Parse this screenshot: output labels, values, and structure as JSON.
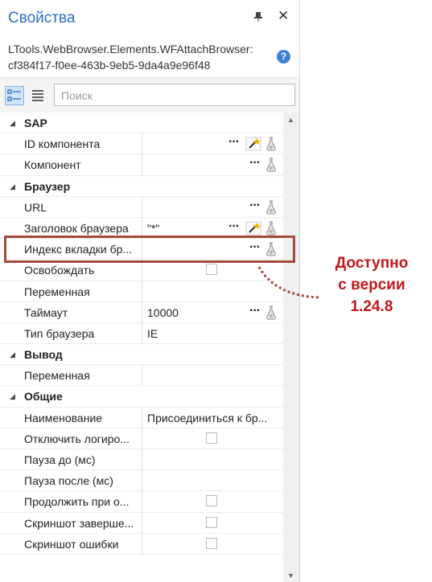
{
  "header": {
    "title": "Свойства",
    "pin_icon": "pin-icon",
    "close_label": "✕"
  },
  "object": {
    "type_line1": "LTools.WebBrowser.Elements.WFAttachBrowser:",
    "type_line2": "cf384f17-f0ee-463b-9eb5-9da4a9e96f48",
    "help_label": "?"
  },
  "toolbar": {
    "search_placeholder": "Поиск"
  },
  "categories": [
    {
      "label": "SAP",
      "props": [
        {
          "name": "ID компонента",
          "value": "",
          "ellipsis": "···"
        },
        {
          "name": "Компонент",
          "value": "",
          "ellipsis": "···"
        }
      ]
    },
    {
      "label": "Браузер",
      "props": [
        {
          "name": "URL",
          "value": "",
          "ellipsis": "···"
        },
        {
          "name": "Заголовок браузера",
          "value": "\"*\"",
          "ellipsis": "···"
        },
        {
          "name": "Индекс вкладки бр...",
          "value": "",
          "ellipsis": "···"
        },
        {
          "name": "Освобождать",
          "value": ""
        },
        {
          "name": "Переменная",
          "value": ""
        },
        {
          "name": "Таймаут",
          "value": "10000",
          "ellipsis": "···"
        },
        {
          "name": "Тип браузера",
          "value": "IE"
        }
      ]
    },
    {
      "label": "Вывод",
      "props": [
        {
          "name": "Переменная",
          "value": ""
        }
      ]
    },
    {
      "label": "Общие",
      "props": [
        {
          "name": "Наименование",
          "value": "Присоединиться к бр..."
        },
        {
          "name": "Отключить логиро...",
          "value": ""
        },
        {
          "name": "Пауза до (мс)",
          "value": ""
        },
        {
          "name": "Пауза после (мс)",
          "value": ""
        },
        {
          "name": "Продолжить при о...",
          "value": ""
        },
        {
          "name": "Скриншот заверше...",
          "value": ""
        },
        {
          "name": "Скриншот ошибки",
          "value": ""
        }
      ]
    }
  ],
  "annotation": {
    "line1": "Доступно",
    "line2": "с версии",
    "line3": "1.24.8",
    "color": "#c0181a"
  },
  "colors": {
    "accent": "#2a6ebd",
    "highlight_border": "#a34a3d"
  }
}
